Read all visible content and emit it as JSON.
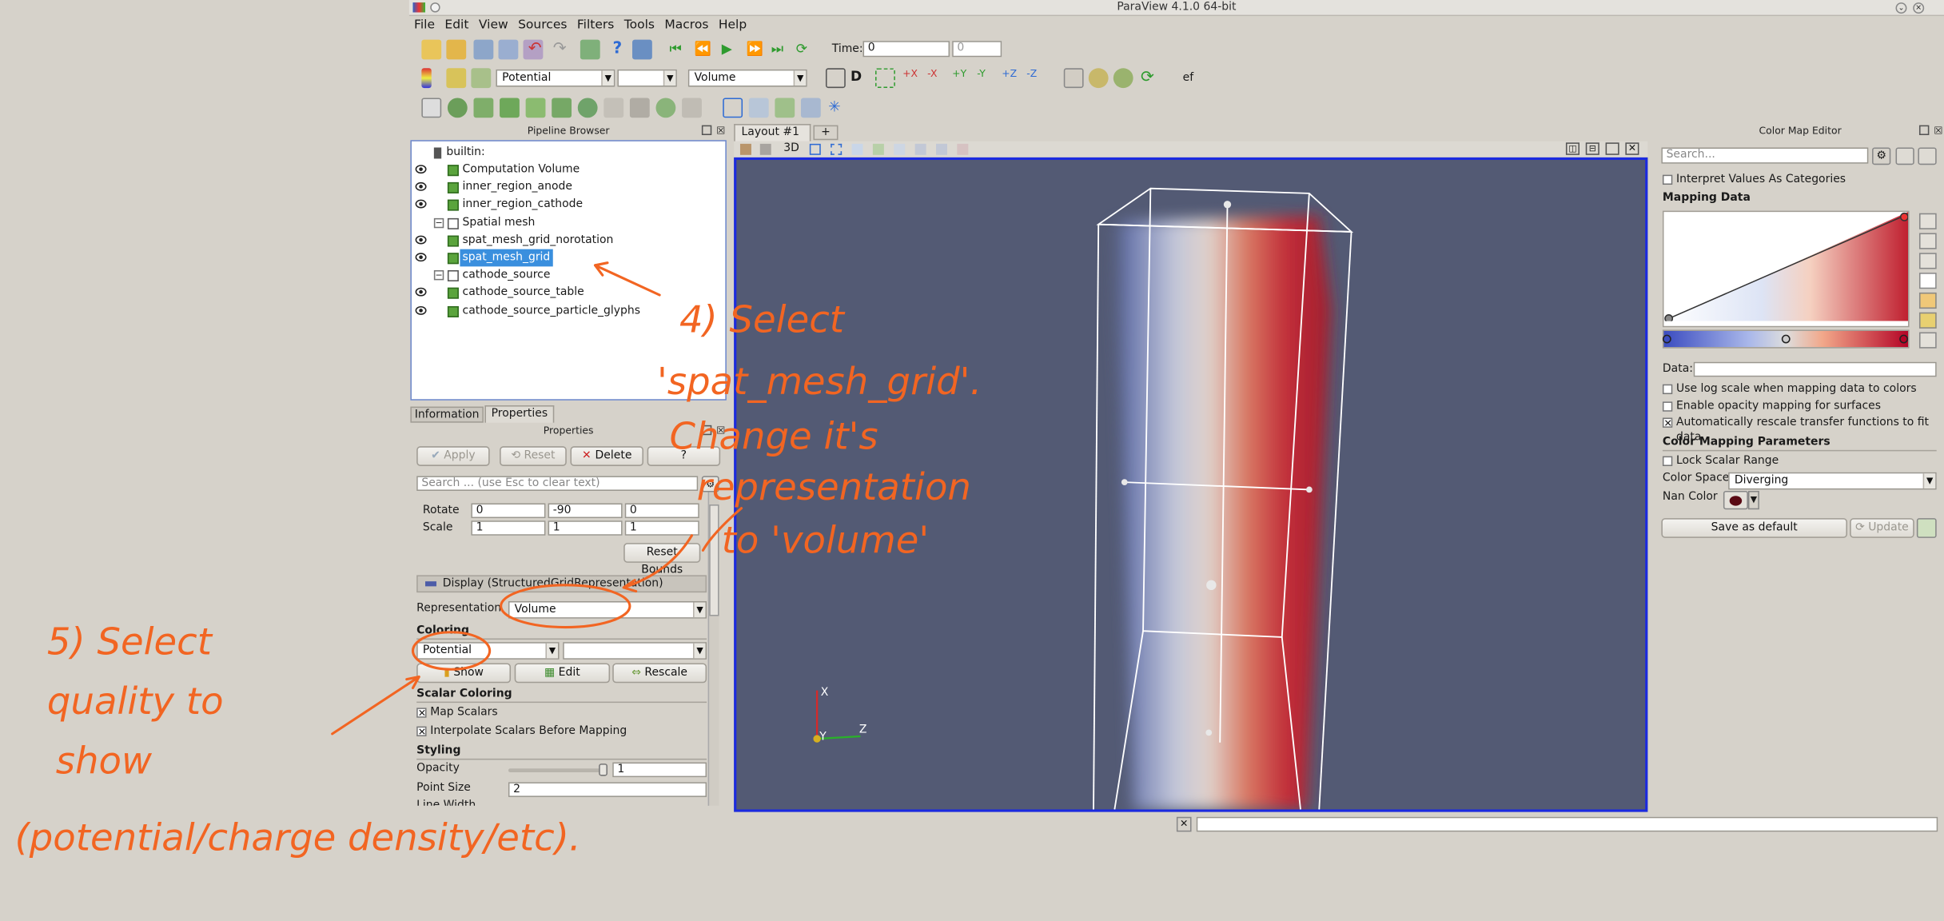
{
  "window": {
    "title": "ParaView 4.1.0 64-bit"
  },
  "menu": [
    "File",
    "Edit",
    "View",
    "Sources",
    "Filters",
    "Tools",
    "Macros",
    "Help"
  ],
  "toolbar": {
    "time_label": "Time:",
    "time_value": "0",
    "time_step": "0",
    "color_array": "Potential",
    "color_component": "",
    "representation": "Volume",
    "extra": "ef"
  },
  "pipeline": {
    "title": "Pipeline Browser",
    "root": "builtin:",
    "items": [
      {
        "label": "Computation Volume",
        "visible": true,
        "type": "cube",
        "indent": 0
      },
      {
        "label": "inner_region_anode",
        "visible": true,
        "type": "cube",
        "indent": 0
      },
      {
        "label": "inner_region_cathode",
        "visible": true,
        "type": "cube",
        "indent": 0
      },
      {
        "label": "Spatial mesh",
        "visible": false,
        "type": "folder",
        "indent": 0
      },
      {
        "label": "spat_mesh_grid_norotation",
        "visible": true,
        "type": "cube",
        "indent": 1
      },
      {
        "label": "spat_mesh_grid",
        "visible": true,
        "type": "cube",
        "indent": 1,
        "selected": true
      },
      {
        "label": "cathode_source",
        "visible": false,
        "type": "folder",
        "indent": 0
      },
      {
        "label": "cathode_source_table",
        "visible": true,
        "type": "cube",
        "indent": 1
      },
      {
        "label": "cathode_source_particle_glyphs",
        "visible": true,
        "type": "cube",
        "indent": 1
      }
    ]
  },
  "tabs": {
    "information": "Information",
    "properties": "Properties"
  },
  "properties": {
    "title": "Properties",
    "apply": "Apply",
    "reset": "Reset",
    "delete": "Delete",
    "help": "?",
    "search_placeholder": "Search ... (use Esc to clear text)",
    "rotate_label": "Rotate",
    "rotate": [
      "0",
      "-90",
      "0"
    ],
    "scale_label": "Scale",
    "scale": [
      "1",
      "1",
      "1"
    ],
    "reset_bounds": "Reset Bounds",
    "display_header": "Display (StructuredGridRepresentation)",
    "representation_label": "Representation",
    "representation_value": "Volume",
    "coloring_label": "Coloring",
    "coloring_value": "Potential",
    "coloring_component": "",
    "show": "Show",
    "edit": "Edit",
    "rescale": "Rescale",
    "scalar_coloring_label": "Scalar Coloring",
    "map_scalars": "Map Scalars",
    "interpolate": "Interpolate Scalars Before Mapping",
    "styling_label": "Styling",
    "opacity_label": "Opacity",
    "opacity_value": "1",
    "point_size_label": "Point Size",
    "point_size_value": "2",
    "line_width_label": "Line Width"
  },
  "layout": {
    "tab": "Layout #1",
    "add": "+",
    "mode3d": "3D"
  },
  "axes": {
    "x": "X",
    "y": "Y",
    "z": "Z"
  },
  "colormap": {
    "title": "Color Map Editor",
    "search_placeholder": "Search...",
    "interpret": "Interpret Values As Categories",
    "mapping_data": "Mapping Data",
    "data_label": "Data:",
    "log_scale": "Use log scale when mapping data to colors",
    "opacity_mapping": "Enable opacity mapping for surfaces",
    "auto_rescale": "Automatically rescale transfer functions to fit data",
    "params": "Color Mapping Parameters",
    "lock_range": "Lock Scalar Range",
    "color_space_label": "Color Space",
    "color_space": "Diverging",
    "nan_color_label": "Nan Color",
    "nan_color": "#5a0a14",
    "save_default": "Save as default",
    "update": "Update"
  },
  "annotations": {
    "a4_l1": "4) Select",
    "a4_l2": "'spat_mesh_grid'.",
    "a4_l3": "Change it's",
    "a4_l4": "representation",
    "a4_l5": "to 'volume'",
    "a5_l1": "5) Select",
    "a5_l2": "quality to",
    "a5_l3": "show",
    "a5_l4": "(potential/charge density/etc)."
  },
  "colors": {
    "selection": "#3a8fde",
    "annotation": "#f26522",
    "viewport_bg": "#535a74",
    "active_border": "#1b2ae0"
  }
}
